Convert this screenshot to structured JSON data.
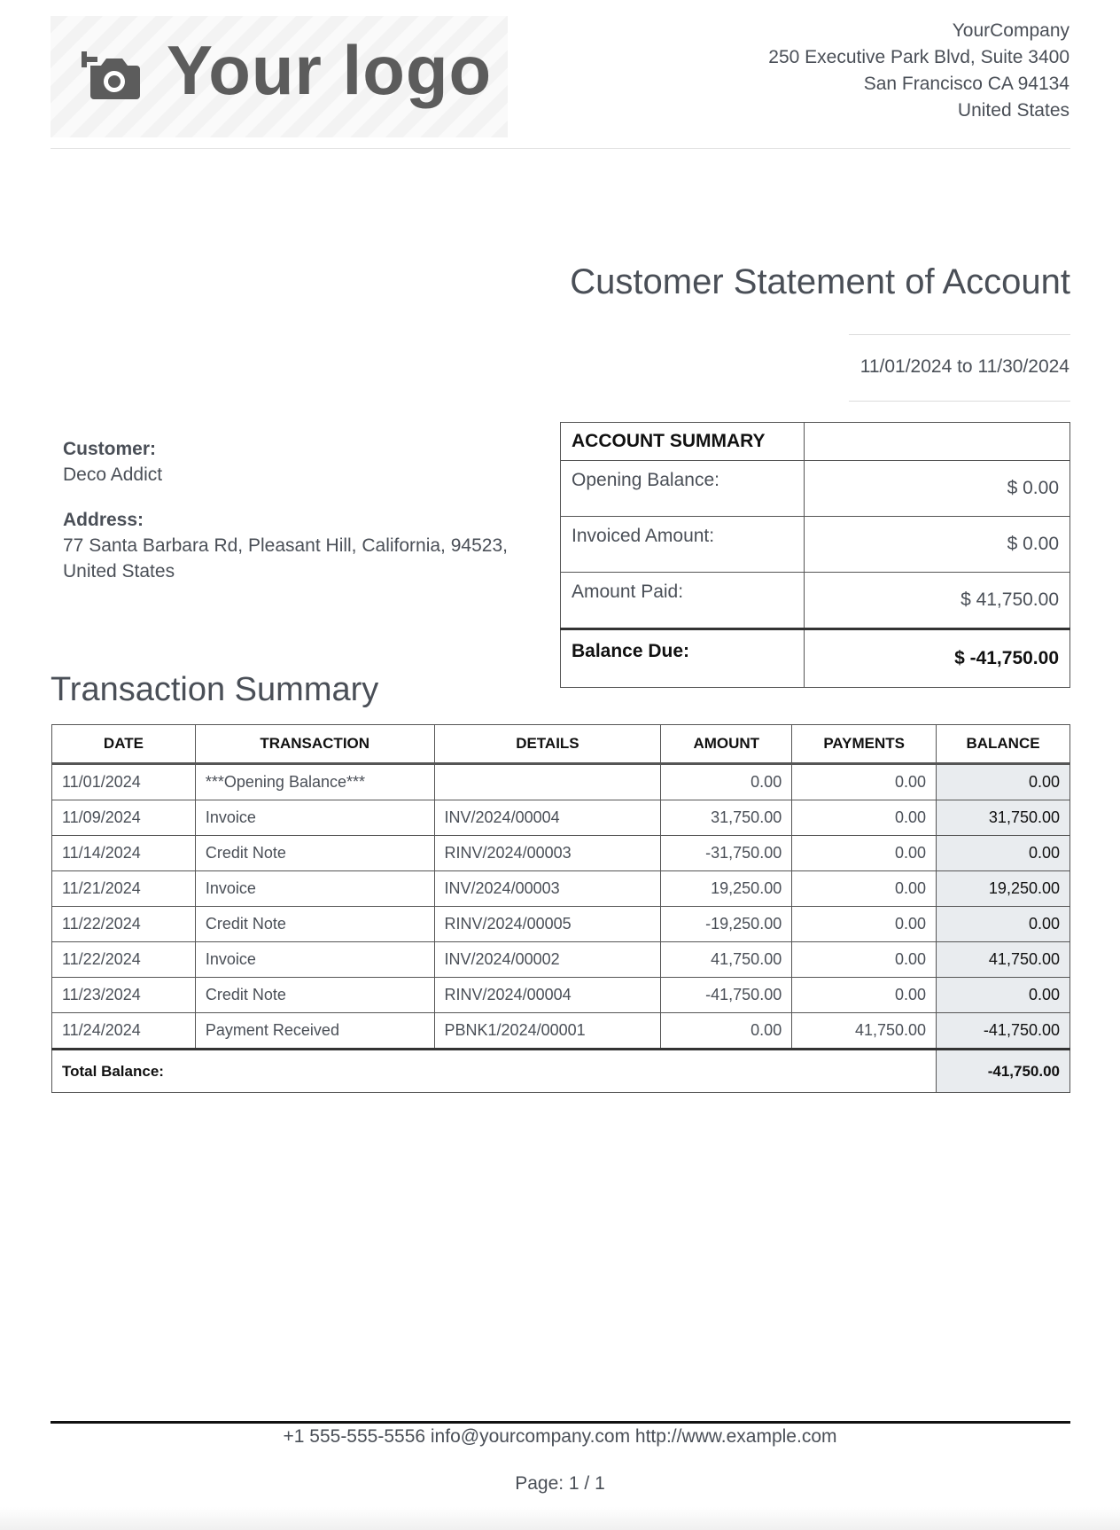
{
  "logo": {
    "text": "Your logo",
    "icon": "camera-plus-icon"
  },
  "company": {
    "name": "YourCompany",
    "address_line1": "250 Executive Park Blvd, Suite 3400",
    "address_line2": "San Francisco CA 94134",
    "country": "United States"
  },
  "title": "Customer Statement of Account",
  "period": "11/01/2024 to 11/30/2024",
  "customer": {
    "name_label": "Customer:",
    "name": "Deco Addict",
    "address_label": "Address:",
    "address": "77 Santa Barbara Rd, Pleasant Hill, California, 94523, United States"
  },
  "account_summary": {
    "header": "ACCOUNT SUMMARY",
    "rows": [
      {
        "label": "Opening Balance:",
        "value": "$ 0.00"
      },
      {
        "label": "Invoiced Amount:",
        "value": "$ 0.00"
      },
      {
        "label": "Amount Paid:",
        "value": "$ 41,750.00"
      }
    ],
    "due_label": "Balance Due:",
    "due_value": "$ -41,750.00"
  },
  "transactions": {
    "title": "Transaction Summary",
    "columns": [
      "DATE",
      "TRANSACTION",
      "DETAILS",
      "AMOUNT",
      "PAYMENTS",
      "BALANCE"
    ],
    "rows": [
      [
        "11/01/2024",
        "***Opening Balance***",
        "",
        "0.00",
        "0.00",
        "0.00"
      ],
      [
        "11/09/2024",
        "Invoice",
        "INV/2024/00004",
        "31,750.00",
        "0.00",
        "31,750.00"
      ],
      [
        "11/14/2024",
        "Credit Note",
        "RINV/2024/00003",
        "-31,750.00",
        "0.00",
        "0.00"
      ],
      [
        "11/21/2024",
        "Invoice",
        "INV/2024/00003",
        "19,250.00",
        "0.00",
        "19,250.00"
      ],
      [
        "11/22/2024",
        "Credit Note",
        "RINV/2024/00005",
        "-19,250.00",
        "0.00",
        "0.00"
      ],
      [
        "11/22/2024",
        "Invoice",
        "INV/2024/00002",
        "41,750.00",
        "0.00",
        "41,750.00"
      ],
      [
        "11/23/2024",
        "Credit Note",
        "RINV/2024/00004",
        "-41,750.00",
        "0.00",
        "0.00"
      ],
      [
        "11/24/2024",
        "Payment Received",
        "PBNK1/2024/00001",
        "0.00",
        "41,750.00",
        "-41,750.00"
      ]
    ],
    "total_label": "Total Balance:",
    "total_value": "-41,750.00"
  },
  "footer": {
    "contact": "+1 555-555-5556 info@yourcompany.com http://www.example.com",
    "page": "Page: 1 / 1"
  }
}
